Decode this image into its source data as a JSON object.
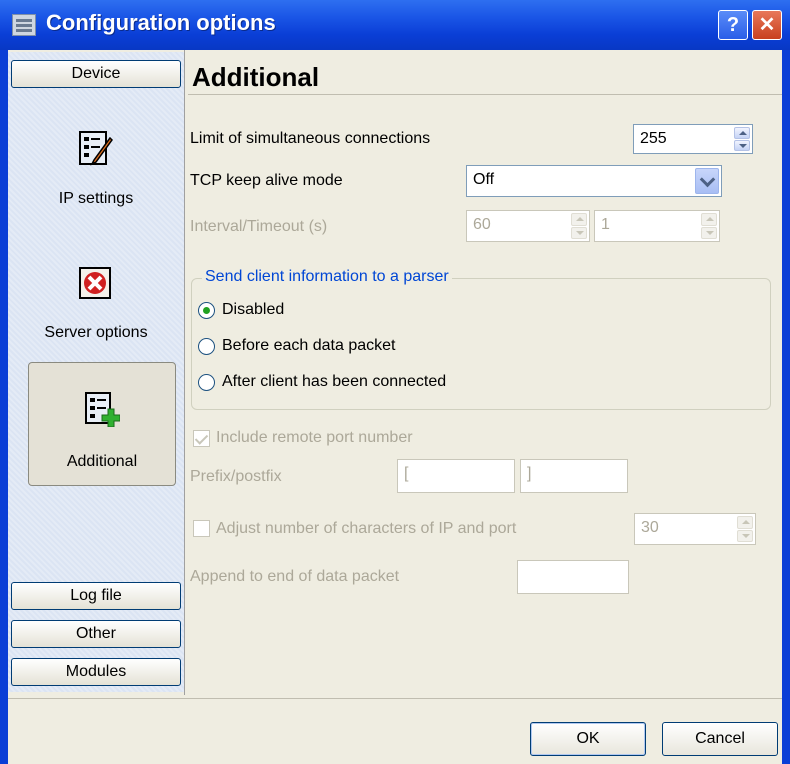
{
  "window": {
    "title": "Configuration options",
    "help_label": "?",
    "close_label": "✕"
  },
  "sidebar": {
    "device_label": "Device",
    "items": [
      {
        "label": "IP settings",
        "icon": "checklist-pen-icon"
      },
      {
        "label": "Server options",
        "icon": "red-x-icon"
      },
      {
        "label": "Additional",
        "icon": "checklist-plus-icon"
      }
    ],
    "log_file_label": "Log file",
    "other_label": "Other",
    "modules_label": "Modules"
  },
  "main": {
    "heading": "Additional",
    "limit_label": "Limit of simultaneous connections",
    "limit_value": "255",
    "keepalive_label": "TCP keep alive mode",
    "keepalive_value": "Off",
    "interval_label": "Interval/Timeout (s)",
    "interval_value": "60",
    "timeout_value": "1",
    "group_title": "Send client information to a parser",
    "radio_disabled": "Disabled",
    "radio_before": "Before each data packet",
    "radio_after": "After client has been connected",
    "include_port_label": "Include remote port number",
    "prefix_label": "Prefix/postfix",
    "prefix_value": "[",
    "postfix_value": "]",
    "adjust_label": "Adjust number of characters of IP and port",
    "adjust_value": "30",
    "append_label": "Append to end of data packet",
    "append_value": ""
  },
  "buttons": {
    "ok": "OK",
    "cancel": "Cancel"
  }
}
